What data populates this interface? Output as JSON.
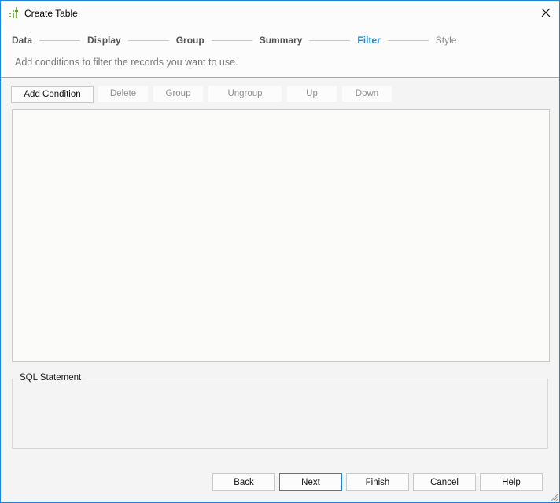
{
  "window": {
    "title": "Create Table",
    "icon": "chart-bars-icon",
    "close_icon": "close-icon"
  },
  "wizard": {
    "steps": [
      {
        "label": "Data",
        "state": "completed"
      },
      {
        "label": "Display",
        "state": "completed"
      },
      {
        "label": "Group",
        "state": "completed"
      },
      {
        "label": "Summary",
        "state": "completed"
      },
      {
        "label": "Filter",
        "state": "active"
      },
      {
        "label": "Style",
        "state": "future"
      }
    ],
    "subtitle": "Add conditions to filter the records you want to use."
  },
  "toolbar": {
    "add_condition": "Add Condition",
    "delete": "Delete",
    "group": "Group",
    "ungroup": "Ungroup",
    "up": "Up",
    "down": "Down"
  },
  "sql": {
    "label": "SQL Statement",
    "value": ""
  },
  "footer": {
    "back": "Back",
    "next": "Next",
    "finish": "Finish",
    "cancel": "Cancel",
    "help": "Help"
  },
  "colors": {
    "accent": "#1a8ad6",
    "border": "#1a86d9",
    "icon_green": "#7ab648"
  }
}
